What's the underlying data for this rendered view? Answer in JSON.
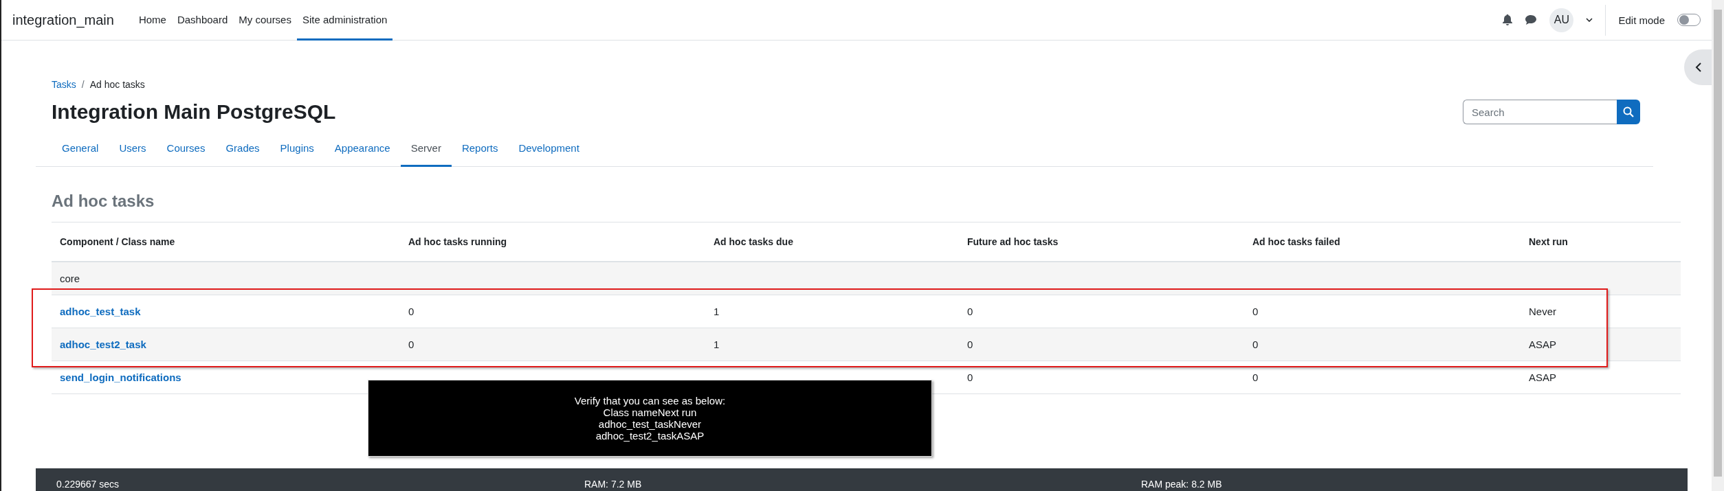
{
  "navbar": {
    "brand": "integration_main",
    "links": [
      {
        "label": "Home",
        "selected": false
      },
      {
        "label": "Dashboard",
        "selected": false
      },
      {
        "label": "My courses",
        "selected": false
      },
      {
        "label": "Site administration",
        "selected": true
      }
    ],
    "avatar": "AU",
    "edit_mode": {
      "label": "Edit mode",
      "on": false
    }
  },
  "breadcrumb": [
    {
      "label": "Tasks",
      "kind": "link"
    },
    {
      "label": "/",
      "kind": "separator"
    },
    {
      "label": "Ad hoc tasks",
      "kind": "current"
    }
  ],
  "page_title": "Integration Main PostgreSQL",
  "search": {
    "placeholder": "Search"
  },
  "tabs": [
    {
      "label": "General",
      "selected": false
    },
    {
      "label": "Users",
      "selected": false
    },
    {
      "label": "Courses",
      "selected": false
    },
    {
      "label": "Grades",
      "selected": false
    },
    {
      "label": "Plugins",
      "selected": false
    },
    {
      "label": "Appearance",
      "selected": false
    },
    {
      "label": "Server",
      "selected": true
    },
    {
      "label": "Reports",
      "selected": false
    },
    {
      "label": "Development",
      "selected": false
    }
  ],
  "section_title": "Ad hoc tasks",
  "table": {
    "columns": [
      "Component / Class name",
      "Ad hoc tasks running",
      "Ad hoc tasks due",
      "Future ad hoc tasks",
      "Ad hoc tasks failed",
      "Next run"
    ],
    "rows": [
      {
        "kind": "group",
        "name": "core"
      },
      {
        "kind": "task",
        "name": "adhoc_test_task",
        "running": "0",
        "due": "1",
        "future": "0",
        "failed": "0",
        "next_run": "Never"
      },
      {
        "kind": "task",
        "name": "adhoc_test2_task",
        "running": "0",
        "due": "1",
        "future": "0",
        "failed": "0",
        "next_run": "ASAP"
      },
      {
        "kind": "task",
        "name": "send_login_notifications",
        "future": "0",
        "failed": "0",
        "next_run": "ASAP"
      }
    ]
  },
  "instruction_overlay": {
    "lines": [
      "Verify that you can see as below:",
      "Class nameNext run",
      "adhoc_test_taskNever",
      "adhoc_test2_taskASAP"
    ]
  },
  "footer": {
    "items": [
      "0.229667 secs",
      "RAM: 7.2 MB",
      "RAM peak: 8.2 MB"
    ]
  }
}
